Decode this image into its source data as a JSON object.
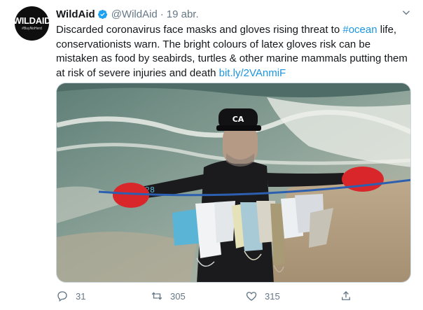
{
  "author": {
    "name": "WildAid",
    "handle": "@WildAid",
    "date": "19 abr.",
    "avatar_logo": "WILDAID",
    "avatar_tag": "#BuyNoHerd"
  },
  "tweet": {
    "text_before": "Discarded coronavirus face masks and gloves rising threat to ",
    "hashtag": "#ocean",
    "text_after": " life, conservationists warn. The bright colours of latex gloves risk can be mistaken as food by seabirds, turtles & other marine mammals putting them at risk of severe injuries and death ",
    "link": "bit.ly/2VAnmiF"
  },
  "media": {
    "cap_text": "CA"
  },
  "actions": {
    "replies": "31",
    "retweets": "305",
    "likes": "315"
  },
  "colors": {
    "link": "#1b95e0",
    "verified": "#1da1f2",
    "muted": "#657786"
  }
}
